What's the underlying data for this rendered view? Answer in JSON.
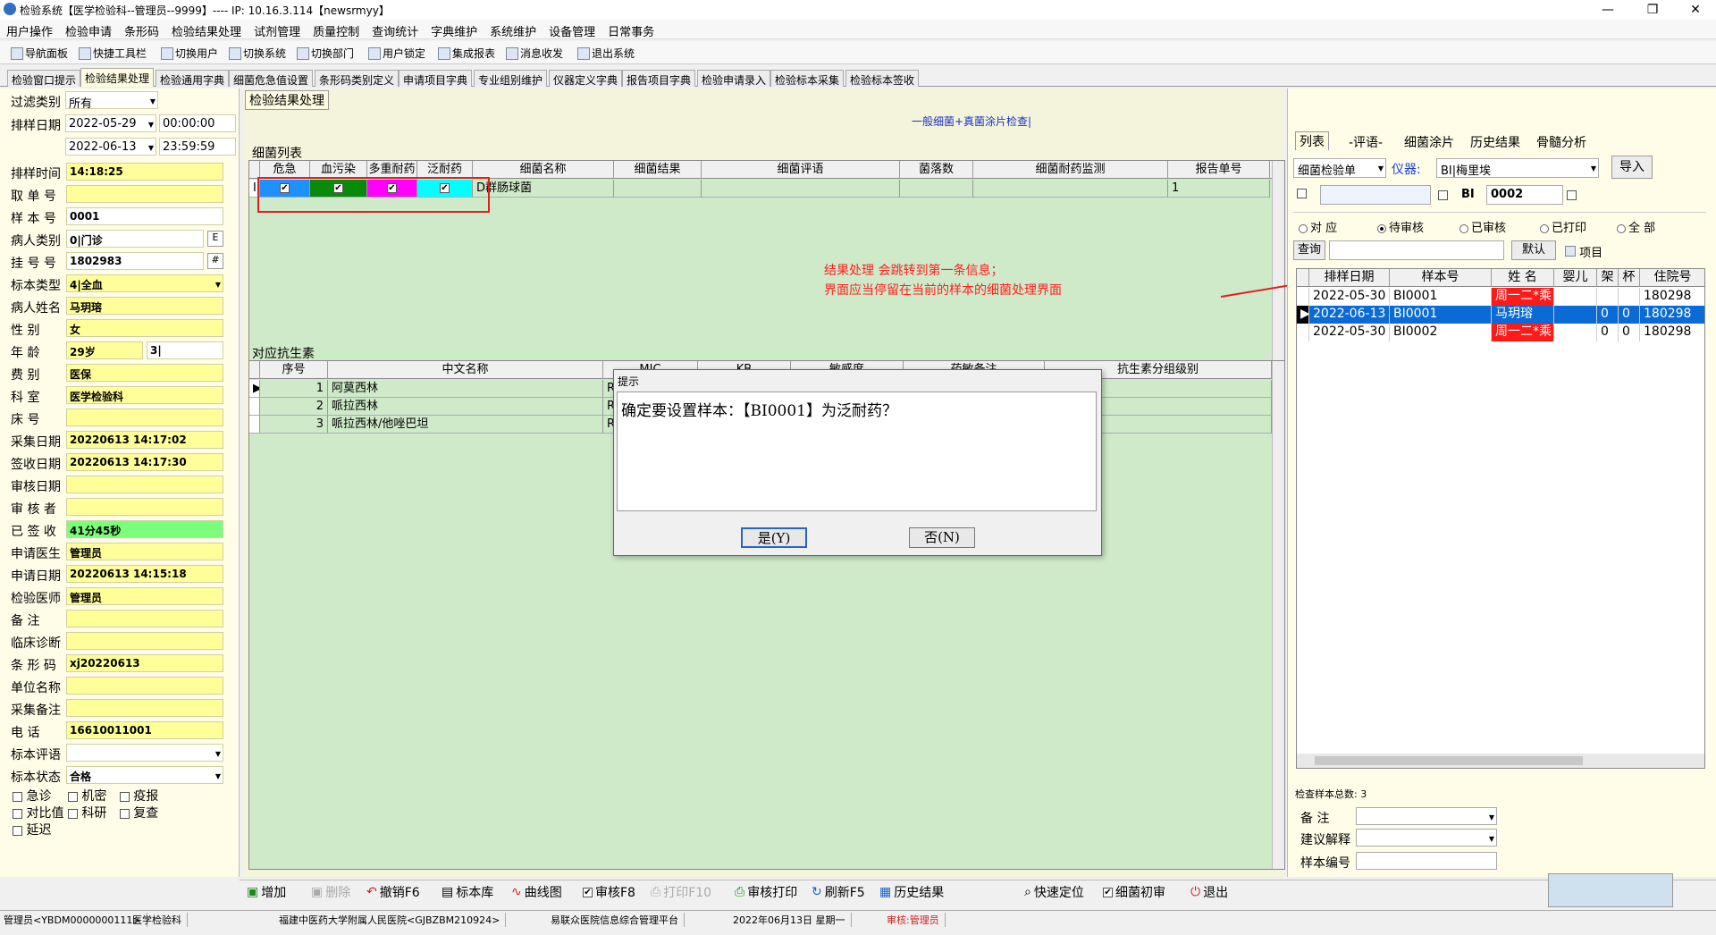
{
  "window": {
    "title": "检验系统【医学检验科--管理员--9999】---- IP: 10.16.3.114【newsrmyy】",
    "controls": [
      "—",
      "❐",
      "✕"
    ]
  },
  "menu": [
    "用户操作",
    "检验申请",
    "条形码",
    "检验结果处理",
    "试剂管理",
    "质量控制",
    "查询统计",
    "字典维护",
    "系统维护",
    "设备管理",
    "日常事务"
  ],
  "toolbar": [
    "导航面板",
    "快捷工具栏",
    "切换用户",
    "切换系统",
    "切换部门",
    "用户锁定",
    "集成报表",
    "消息收发",
    "退出系统"
  ],
  "tabs": [
    "检验窗口提示",
    "检验结果处理",
    "检验通用字典",
    "细菌危急值设置",
    "条形码类别定义",
    "申请项目字典",
    "专业组别维护",
    "仪器定义字典",
    "报告项目字典",
    "检验申请录入",
    "检验标本采集",
    "检验标本签收"
  ],
  "left": {
    "filter_label": "过滤类别",
    "filter_value": "所有",
    "date_label": "排样日期",
    "date_from": "2022-05-29",
    "time_from": "00:00:00",
    "date_to": "2022-06-13",
    "time_to": "23:59:59",
    "fields": [
      {
        "label": "排样时间",
        "value": "14:18:25"
      },
      {
        "label": "取 单 号",
        "value": ""
      },
      {
        "label": "样 本 号",
        "value": "0001"
      },
      {
        "label": "病人类别",
        "value": "0|门诊"
      },
      {
        "label": "挂 号 号",
        "value": "1802983"
      },
      {
        "label": "标本类型",
        "value": "4|全血"
      },
      {
        "label": "病人姓名",
        "value": "马玥瑢"
      },
      {
        "label": "性    别",
        "value": "女"
      },
      {
        "label": "年    龄",
        "value": "29岁"
      },
      {
        "label": "费    别",
        "value": "医保"
      },
      {
        "label": "科    室",
        "value": "医学检验科"
      },
      {
        "label": "床    号",
        "value": ""
      },
      {
        "label": "采集日期",
        "value": "20220613 14:17:02"
      },
      {
        "label": "签收日期",
        "value": "20220613 14:17:30"
      },
      {
        "label": "审核日期",
        "value": ""
      },
      {
        "label": "审 核 者",
        "value": ""
      },
      {
        "label": "已 签 收",
        "value": "41分45秒"
      },
      {
        "label": "申请医生",
        "value": "管理员"
      },
      {
        "label": "申请日期",
        "value": "20220613 14:15:18"
      },
      {
        "label": "检验医师",
        "value": "管理员"
      },
      {
        "label": "备    注",
        "value": ""
      },
      {
        "label": "临床诊断",
        "value": ""
      },
      {
        "label": "条 形 码",
        "value": "xj20220613"
      },
      {
        "label": "单位名称",
        "value": ""
      },
      {
        "label": "采集备注",
        "value": ""
      },
      {
        "label": "电    话",
        "value": "16610011001"
      },
      {
        "label": "标本评语",
        "value": ""
      },
      {
        "label": "标本状态",
        "value": "合格"
      }
    ],
    "age_unit": "3|",
    "btn_e": "E",
    "btn_hash": "#",
    "checks": [
      "急诊",
      "机密",
      "疫报",
      "对比值",
      "科研",
      "复查",
      "延迟"
    ]
  },
  "center": {
    "tab": "检验结果处理",
    "exam_link": "一般细菌+真菌涂片检查|",
    "bacteria_title": "细菌列表",
    "bacteria_headers": [
      "危急",
      "血污染",
      "多重耐药",
      "泛耐药",
      "细菌名称",
      "细菌结果",
      "细菌评语",
      "菌落数",
      "细菌耐药监测",
      "报告单号"
    ],
    "bacteria_rows": [
      {
        "marker": "I",
        "name": "D群肠球菌",
        "report": "1"
      }
    ],
    "antibiotic_title": "对应抗生素",
    "antibiotic_headers": [
      "序号",
      "中文名称",
      "MIC",
      "KB",
      "敏感度",
      "药敏备注",
      "抗生素分组级别"
    ],
    "antibiotic_rows": [
      {
        "no": "1",
        "name": "阿莫西林",
        "mic": "RI"
      },
      {
        "no": "2",
        "name": "哌拉西林",
        "mic": "RI"
      },
      {
        "no": "3",
        "name": "哌拉西林/他唑巴坦",
        "mic": "RI"
      }
    ]
  },
  "dialog": {
    "title": "提示",
    "message": "确定要设置样本：【BI0001】为泛耐药？",
    "yes": "是(Y)",
    "no": "否(N)"
  },
  "annotation": {
    "line1": "结果处理 会跳转到第一条信息；",
    "line2": "界面应当停留在当前的样本的细菌处理界面"
  },
  "right": {
    "tabs": [
      "列表",
      "-评语-",
      "细菌涂片",
      "历史结果",
      "骨髓分析"
    ],
    "source": "细菌检验单",
    "instrument_label": "仪器:",
    "instrument_value": "BI|梅里埃",
    "import_btn": "导入",
    "code_prefix": "BI",
    "code_value": "0002",
    "radios": [
      "对 应",
      "待审核",
      "已审核",
      "已打印",
      "全 部"
    ],
    "query_btn": "查询",
    "default_btn": "默认",
    "item_btn": "项目",
    "grid_headers": [
      "排样日期",
      "样本号",
      "姓 名",
      "婴儿",
      "架",
      "杯",
      "住院号"
    ],
    "grid_rows": [
      {
        "date": "2022-05-30",
        "sample": "BI0001",
        "name": "周一二*乘",
        "baby": "",
        "rack": "",
        "cup": "",
        "inpat": "180298"
      },
      {
        "date": "2022-06-13",
        "sample": "BI0001",
        "name": "马玥瑢",
        "baby": "",
        "rack": "0",
        "cup": "0",
        "inpat": "180298"
      },
      {
        "date": "2022-05-30",
        "sample": "BI0002",
        "name": "周一二*乘",
        "baby": "",
        "rack": "0",
        "cup": "0",
        "inpat": "180298"
      }
    ],
    "total_label": "检查样本总数: 3",
    "memo_label": "备    注",
    "suggest_label": "建议解释",
    "sample_no_label": "样本编号"
  },
  "bottom": [
    "增加",
    "删除",
    "撤销F6",
    "标本库",
    "曲线图",
    "审核F8",
    "打印F10",
    "审核打印",
    "刷新F5",
    "历史结果",
    "快速定位",
    "细菌初审",
    "退出"
  ],
  "status": [
    "管理员<YBDM0000000111>",
    "医学检验科",
    "福建中医药大学附属人民医院<GJBZBM210924>",
    "易联众医院信息综合管理平台",
    "2022年06月13日 星期一",
    "审核:管理员"
  ],
  "colors": {
    "danger": "#1e90ff",
    "blood": "#0a8a0a",
    "multi": "#ff00ff",
    "pan": "#00ffff",
    "red_name": "#ff1a1a",
    "selected_row": "#0a6ad6"
  }
}
